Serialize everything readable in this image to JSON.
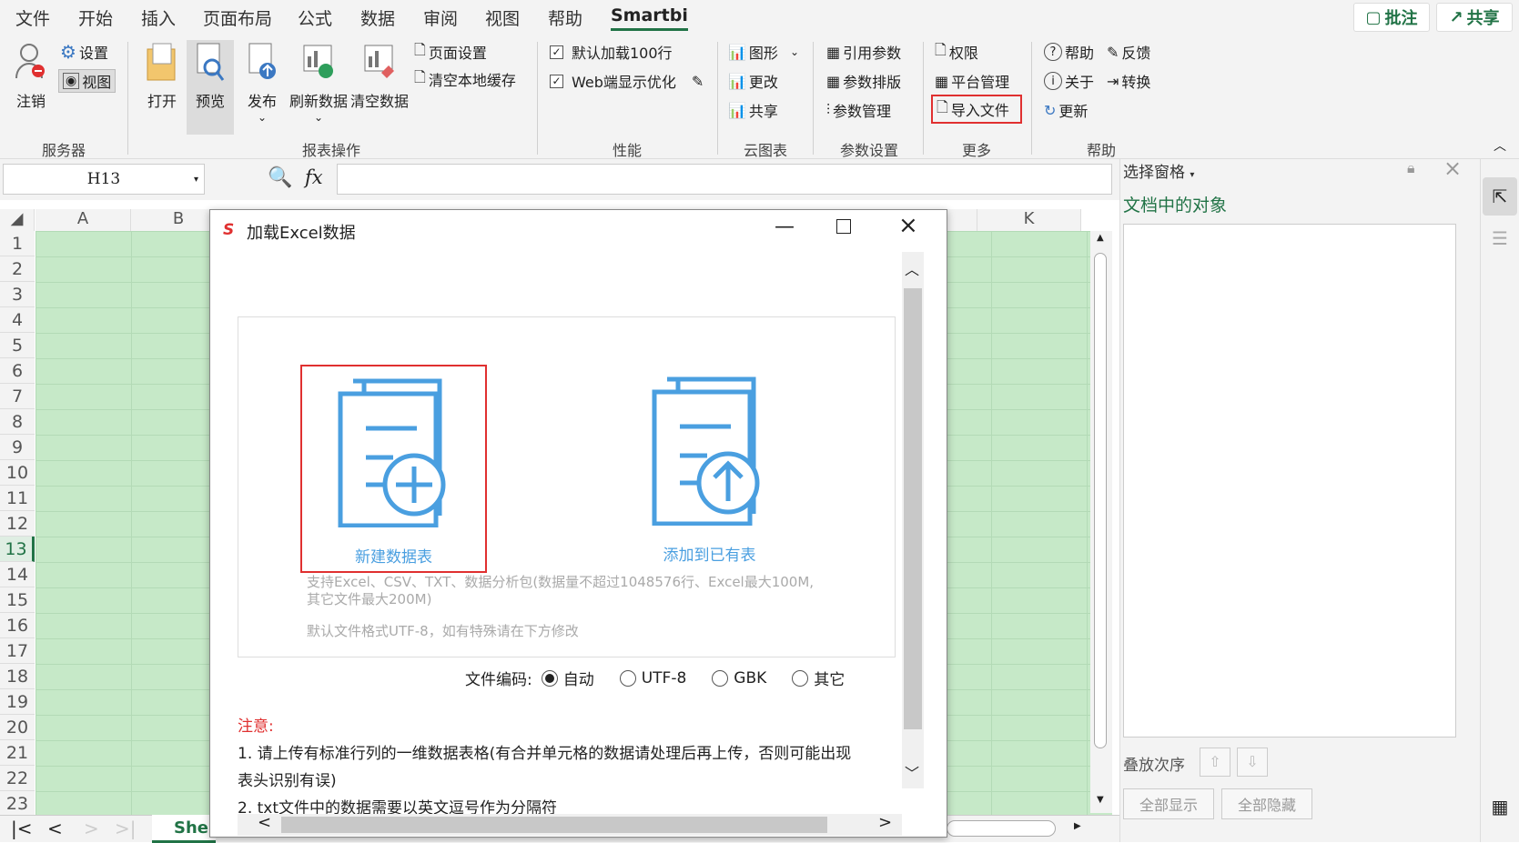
{
  "menu": {
    "tabs": [
      "文件",
      "开始",
      "插入",
      "页面布局",
      "公式",
      "数据",
      "审阅",
      "视图",
      "帮助",
      "Smartbi"
    ],
    "active": "Smartbi",
    "comment": "批注",
    "share": "共享"
  },
  "ribbon": {
    "server": {
      "label": "服务器",
      "logout": "注销",
      "settings": "设置",
      "view": "视图"
    },
    "report": {
      "label": "报表操作",
      "open": "打开",
      "preview": "预览",
      "publish": "发布",
      "refresh": "刷新数据",
      "clear": "清空数据",
      "page_setup": "页面设置",
      "clear_cache": "清空本地缓存"
    },
    "perf": {
      "label": "性能",
      "load100": "默认加载100行",
      "web_opt": "Web端显示优化"
    },
    "cloud": {
      "label": "云图表",
      "chart": "图形",
      "modify": "更改",
      "share": "共享"
    },
    "params": {
      "label": "参数设置",
      "ref": "引用参数",
      "layout": "参数排版",
      "manage": "参数管理"
    },
    "more": {
      "label": "更多",
      "permission": "权限",
      "platform": "平台管理",
      "import": "导入文件"
    },
    "help": {
      "label": "帮助",
      "help": "帮助",
      "feedback": "反馈",
      "about": "关于",
      "convert": "转换",
      "update": "更新"
    }
  },
  "formula": {
    "namebox": "H13",
    "fx": "fx",
    "value": ""
  },
  "grid": {
    "columns": [
      "A",
      "B",
      "K"
    ],
    "rows": [
      "1",
      "2",
      "3",
      "4",
      "5",
      "6",
      "7",
      "8",
      "9",
      "10",
      "11",
      "12",
      "13",
      "14",
      "15",
      "16",
      "17",
      "18",
      "19",
      "20",
      "21",
      "22",
      "23"
    ],
    "active_row": "13",
    "sheet_tab": "She"
  },
  "dialog": {
    "title": "加载Excel数据",
    "new_table": "新建数据表",
    "add_existing": "添加到已有表",
    "support_line1": "支持Excel、CSV、TXT、数据分析包(数据量不超过1048576行、Excel最大100M,",
    "support_line2": "其它文件最大200M)",
    "default_enc": "默认文件格式UTF-8，如有特殊请在下方修改",
    "enc_label": "文件编码:",
    "enc_options": [
      "自动",
      "UTF-8",
      "GBK",
      "其它"
    ],
    "enc_selected": "自动",
    "note_title": "注意:",
    "note1a": "1. 请上传有标准行列的一维数据表格(有合并单元格的数据请处理后再上传，否则可能出现",
    "note1b": "表头识别有误)",
    "note2": "2. txt文件中的数据需要以英文逗号作为分隔符"
  },
  "pane": {
    "title": "选择窗格",
    "subtitle": "文档中的对象",
    "order": "叠放次序",
    "show_all": "全部显示",
    "hide_all": "全部隐藏"
  },
  "colors": {
    "accent": "#217346",
    "dialog_blue": "#4a9fe0",
    "highlight_red": "#e03030",
    "note_red": "#e03030",
    "cells": "#c6e9c8"
  }
}
